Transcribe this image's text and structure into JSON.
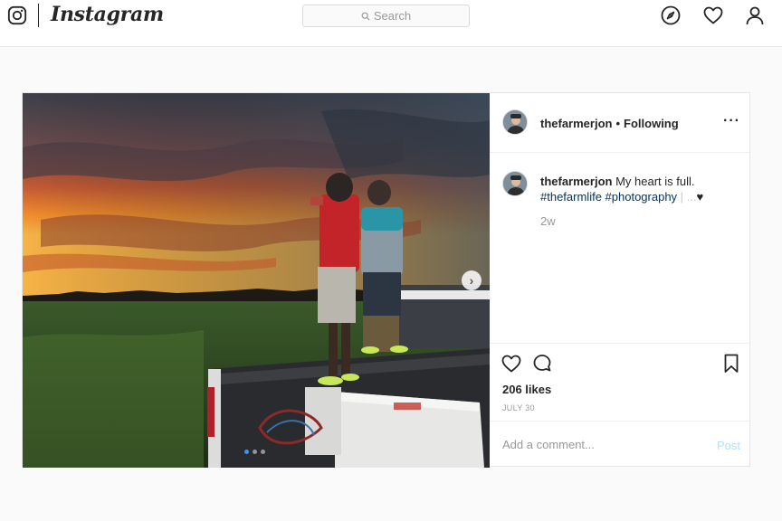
{
  "nav": {
    "brand": "Instagram",
    "search_placeholder": "Search",
    "icons": [
      "instagram-glyph-icon",
      "compass-icon",
      "heart-icon",
      "user-icon"
    ]
  },
  "post": {
    "username": "thefarmerjon",
    "separator": "•",
    "follow_status": "Following",
    "more_label": "···",
    "caption": {
      "username": "thefarmerjon",
      "text": "My heart is full.",
      "hashtags": "#thefarmlife #photography",
      "trailing": "| ...",
      "emoji": "♥"
    },
    "time_ago": "2w",
    "likes": "206 likes",
    "date": "JULY 30",
    "comment_placeholder": "Add a comment...",
    "post_label": "Post",
    "carousel": {
      "count": 3,
      "active_index": 0
    },
    "next_label": "›"
  },
  "colors": {
    "link_blue": "#003569",
    "accent": "#3897f0",
    "post_disabled": "#b2dffc",
    "muted": "#999999"
  }
}
